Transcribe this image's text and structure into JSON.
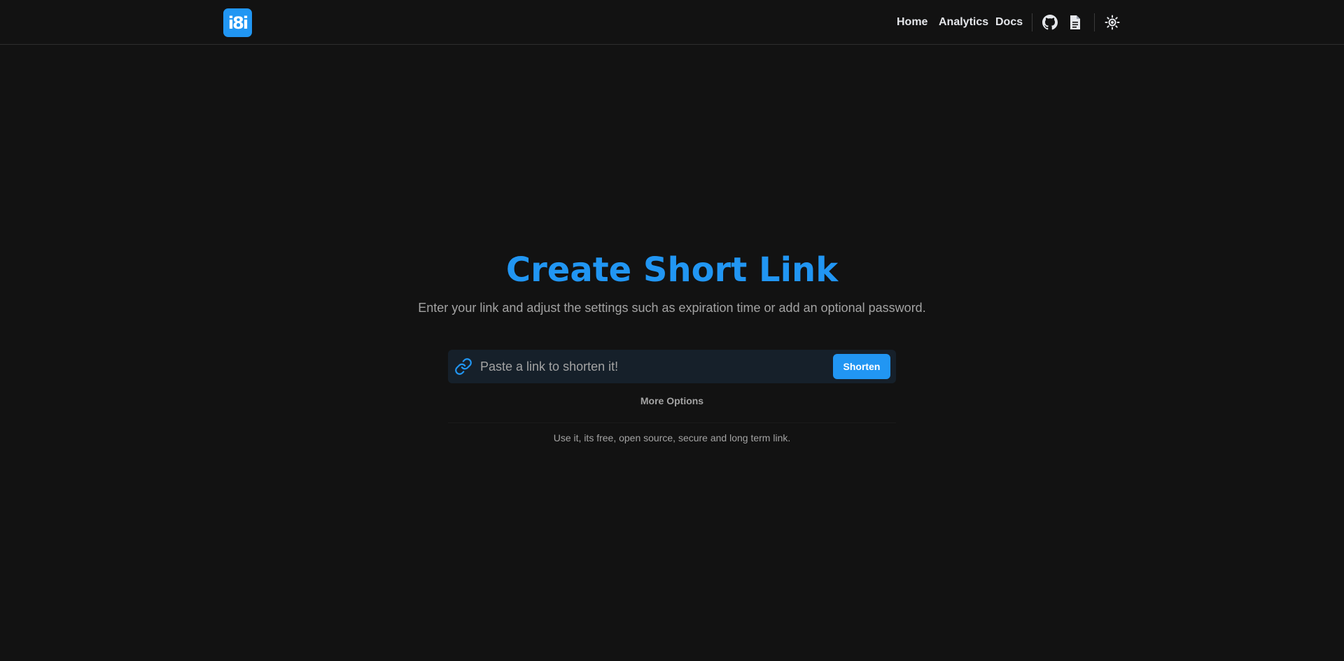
{
  "brand": {
    "logo_text": "i8i",
    "accent_color": "#2196f3"
  },
  "nav": {
    "links": [
      {
        "label": "Home"
      },
      {
        "label": "Analytics"
      },
      {
        "label": "Docs"
      }
    ],
    "icons": [
      "github-icon",
      "document-icon",
      "theme-toggle-icon"
    ]
  },
  "hero": {
    "title": "Create Short Link",
    "subtitle": "Enter your link and adjust the settings such as expiration time or add an optional password."
  },
  "shortener": {
    "input_placeholder": "Paste a link to shorten it!",
    "input_value": "",
    "button_label": "Shorten",
    "icon": "link-icon"
  },
  "more_options_label": "More Options",
  "tagline": "Use it, its free, open source, secure and long term link."
}
